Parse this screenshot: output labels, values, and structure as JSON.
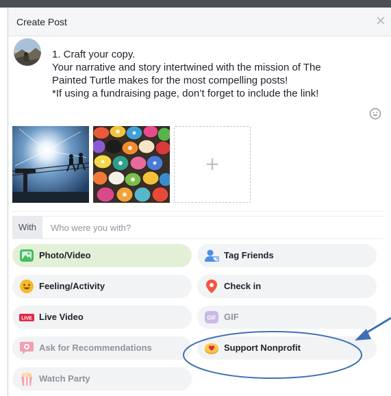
{
  "dialog": {
    "title": "Create Post",
    "close_glyph": "×"
  },
  "composer": {
    "lines": [
      "1.    Craft your copy.",
      "Your narrative and story intertwined with the mission of The",
      "Painted Turtle makes for the most compelling posts!",
      "*If using a fundraising page, don’t forget to include the link!"
    ]
  },
  "media": {
    "add_glyph": "+"
  },
  "with": {
    "label": "With",
    "placeholder": "Who were you with?"
  },
  "options": {
    "photo_video": "Photo/Video",
    "tag_friends": "Tag Friends",
    "feeling_activity": "Feeling/Activity",
    "check_in": "Check in",
    "live_video": "Live Video",
    "live_badge": "LIVE",
    "gif": "GIF",
    "gif_badge": "GIF",
    "ask_recommendations": "Ask for Recommendations",
    "support_nonprofit": "Support Nonprofit",
    "watch_party": "Watch Party"
  },
  "colors": {
    "active_bg": "#e3f0d8",
    "annotation": "#3f6fb5"
  }
}
